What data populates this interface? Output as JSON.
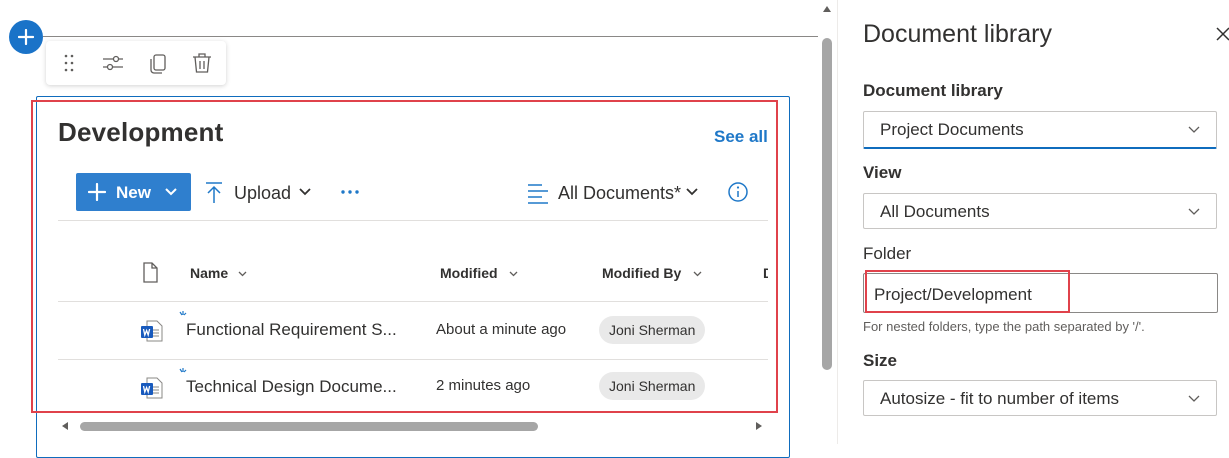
{
  "webpart": {
    "title": "Development",
    "see_all": "See all",
    "commands": {
      "new_label": "New",
      "upload_label": "Upload",
      "more_label": "···",
      "view_label": "All Documents*"
    },
    "columns": {
      "name": "Name",
      "modified": "Modified",
      "modified_by": "Modified By",
      "next": "D"
    },
    "rows": [
      {
        "name": "Functional Requirement S...",
        "modified": "About a minute ago",
        "modified_by": "Joni Sherman",
        "icon": "word-file-icon"
      },
      {
        "name": "Technical Design Docume...",
        "modified": "2 minutes ago",
        "modified_by": "Joni Sherman",
        "icon": "word-file-icon"
      }
    ]
  },
  "property_pane": {
    "title": "Document library",
    "library_label": "Document library",
    "library_value": "Project Documents",
    "view_label": "View",
    "view_value": "All Documents",
    "folder_label": "Folder",
    "folder_value": "Project/Development",
    "folder_hint": "For nested folders, type the path separated by '/'.",
    "size_label": "Size",
    "size_value": "Autosize - fit to number of items"
  },
  "colors": {
    "accent": "#0f6cbd",
    "new_button": "#2f7fce",
    "highlight_box": "#e0424b",
    "word_blue": "#185abd"
  }
}
